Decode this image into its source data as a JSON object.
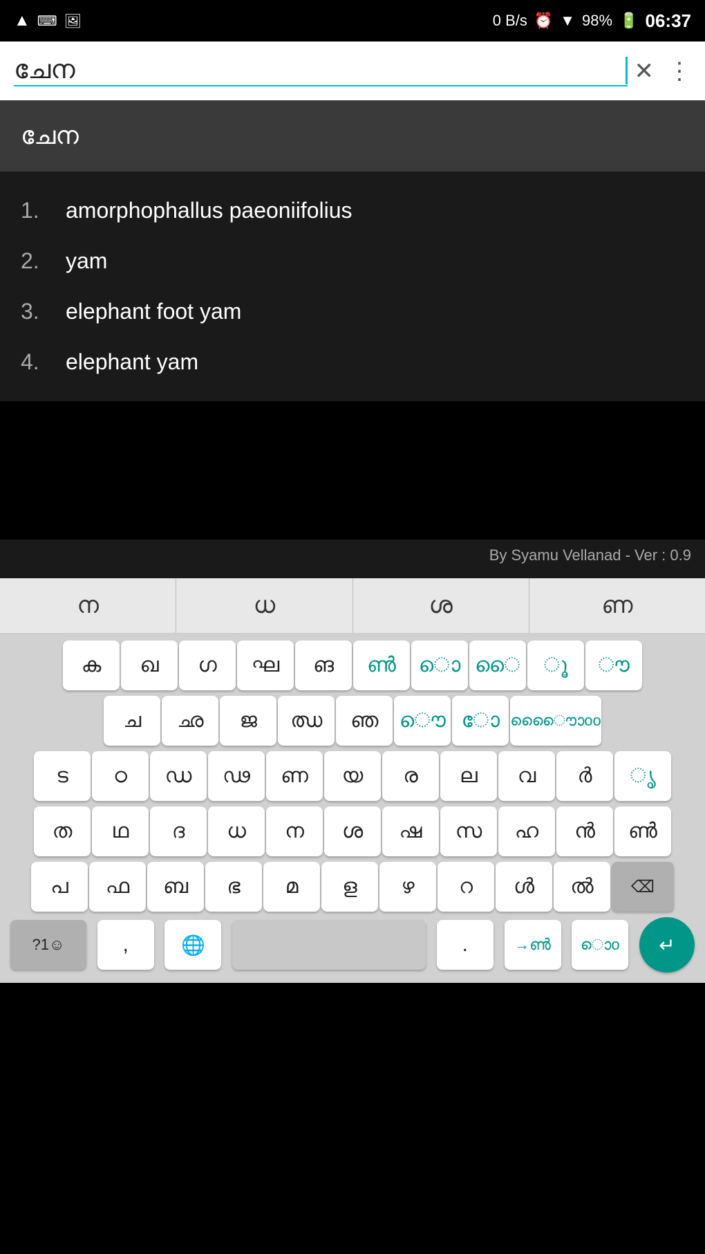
{
  "statusBar": {
    "signal": "▲",
    "network": "0 B/s",
    "alarm": "⏰",
    "wifi": "▼",
    "battery": "98%",
    "time": "06:37"
  },
  "searchBar": {
    "query": "ചേന",
    "clearLabel": "×",
    "moreLabel": "⋮"
  },
  "suggestion": {
    "text": "ചേന"
  },
  "results": [
    {
      "number": "1.",
      "text": "amorphophallus paeoniifolius"
    },
    {
      "number": "2.",
      "text": "yam"
    },
    {
      "number": "3.",
      "text": "elephant foot yam"
    },
    {
      "number": "4.",
      "text": "elephant yam"
    }
  ],
  "watermark": "By Syamu Vellanad - Ver : 0.9",
  "suggestionRow": [
    "ന",
    "ധ",
    "ശ",
    "ണ"
  ],
  "keyboardRows": [
    [
      "ക",
      "ഖ",
      "ഗ",
      "ഘ",
      "ങ",
      "ൺ",
      "ൊ",
      "ൈ",
      "ൂ",
      "ൗ"
    ],
    [
      "ച",
      "ഛ",
      "ജ",
      "ഝ",
      "ഞ",
      "ൌ",
      "ോ",
      "ൈൌൊoo",
      "teal1"
    ],
    [
      "ട",
      "ഠ",
      "ഡ",
      "ഢ",
      "ണ",
      "യ",
      "ര",
      "ല",
      "വ",
      "ർ",
      "ൃ"
    ],
    [
      "ത",
      "ഥ",
      "ദ",
      "ധ",
      "ന",
      "ശ",
      "ഷ",
      "സ",
      "ഹ",
      "ൻ",
      "ൺ"
    ],
    [
      "പ",
      "ഫ",
      "ബ",
      "ഭ",
      "മ",
      "ള",
      "ഴ",
      "റ",
      "ൾ",
      "ൽ",
      "⌫"
    ],
    [
      "?1☺",
      ",",
      "🌐",
      "SPACE",
      ".",
      "→ൺ",
      "ൊo",
      "ENTER"
    ]
  ],
  "keyboardRow1": [
    "ക",
    "ഖ",
    "ഗ",
    "ഘ",
    "ങ"
  ],
  "keyboardRow1Teal": [
    "ൺ",
    "ൊ",
    "ൈ",
    "ൂ",
    "ൗ"
  ],
  "keyboardRow2": [
    "ച",
    "ഛ",
    "ജ",
    "ഝ",
    "ഞ"
  ],
  "keyboardRow2Teal": [
    "ൌ",
    "ോ",
    "ൈ",
    "ൊo"
  ],
  "keyboardRow3": [
    "ട",
    "ഠ",
    "ഡ",
    "ഢ",
    "ണ",
    "യ",
    "ര",
    "ല",
    "വ",
    "ർ",
    "ൃ"
  ],
  "keyboardRow4": [
    "ത",
    "ഥ",
    "ദ",
    "ധ",
    "ന",
    "ശ",
    "ഷ",
    "സ",
    "ഹ",
    "ൻ",
    "ൺ"
  ],
  "keyboardRow5": [
    "പ",
    "ഫ",
    "ബ",
    "ഭ",
    "മ",
    "ള",
    "ഴ",
    "റ",
    "ൾ",
    "ൽ"
  ],
  "bottomRow": {
    "symbol": "?1☺",
    "comma": ",",
    "globe": "🌐",
    "period": ".",
    "arrows": "→ൺ",
    "dots": "ൊo",
    "backspace": "⌫",
    "enter": "↵"
  }
}
